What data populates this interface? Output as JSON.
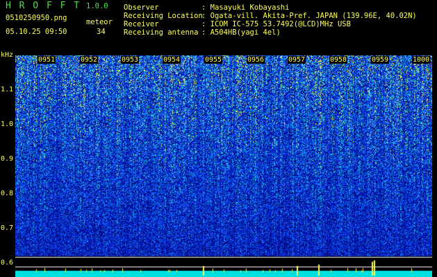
{
  "app": {
    "title": "H R O F F T",
    "version": "1.0.0"
  },
  "file": {
    "name": "0510250950.png",
    "datetime": "05.10.25 09:50"
  },
  "meteor": {
    "label": "meteor",
    "count": "34"
  },
  "info": [
    {
      "label": "Observer",
      "value": ": Masayuki Kobayashi"
    },
    {
      "label": "Receiving Location",
      "value": ": Ogata-vill. Akita-Pref. JAPAN (139.96E, 40.02N)"
    },
    {
      "label": "Receiver",
      "value": ": ICOM IC-575 53.7492(@LCD)MHz USB"
    },
    {
      "label": "Receiving antenna",
      "value": ": A504HB(yagi 4el)"
    }
  ],
  "y_axis": {
    "unit": "kHz",
    "ticks": [
      "1.1",
      "1.0",
      "0.9",
      "0.8",
      "0.7",
      "0.6"
    ]
  },
  "time_labels": [
    "0951",
    "0952",
    "0953",
    "0954",
    "0955",
    "0956",
    "0957",
    "0958",
    "0959",
    "1000"
  ],
  "colors": {
    "accent_green": "#4be04b",
    "label_yellow": "#ffff55",
    "spectrum_blue": "#1a3cff"
  }
}
